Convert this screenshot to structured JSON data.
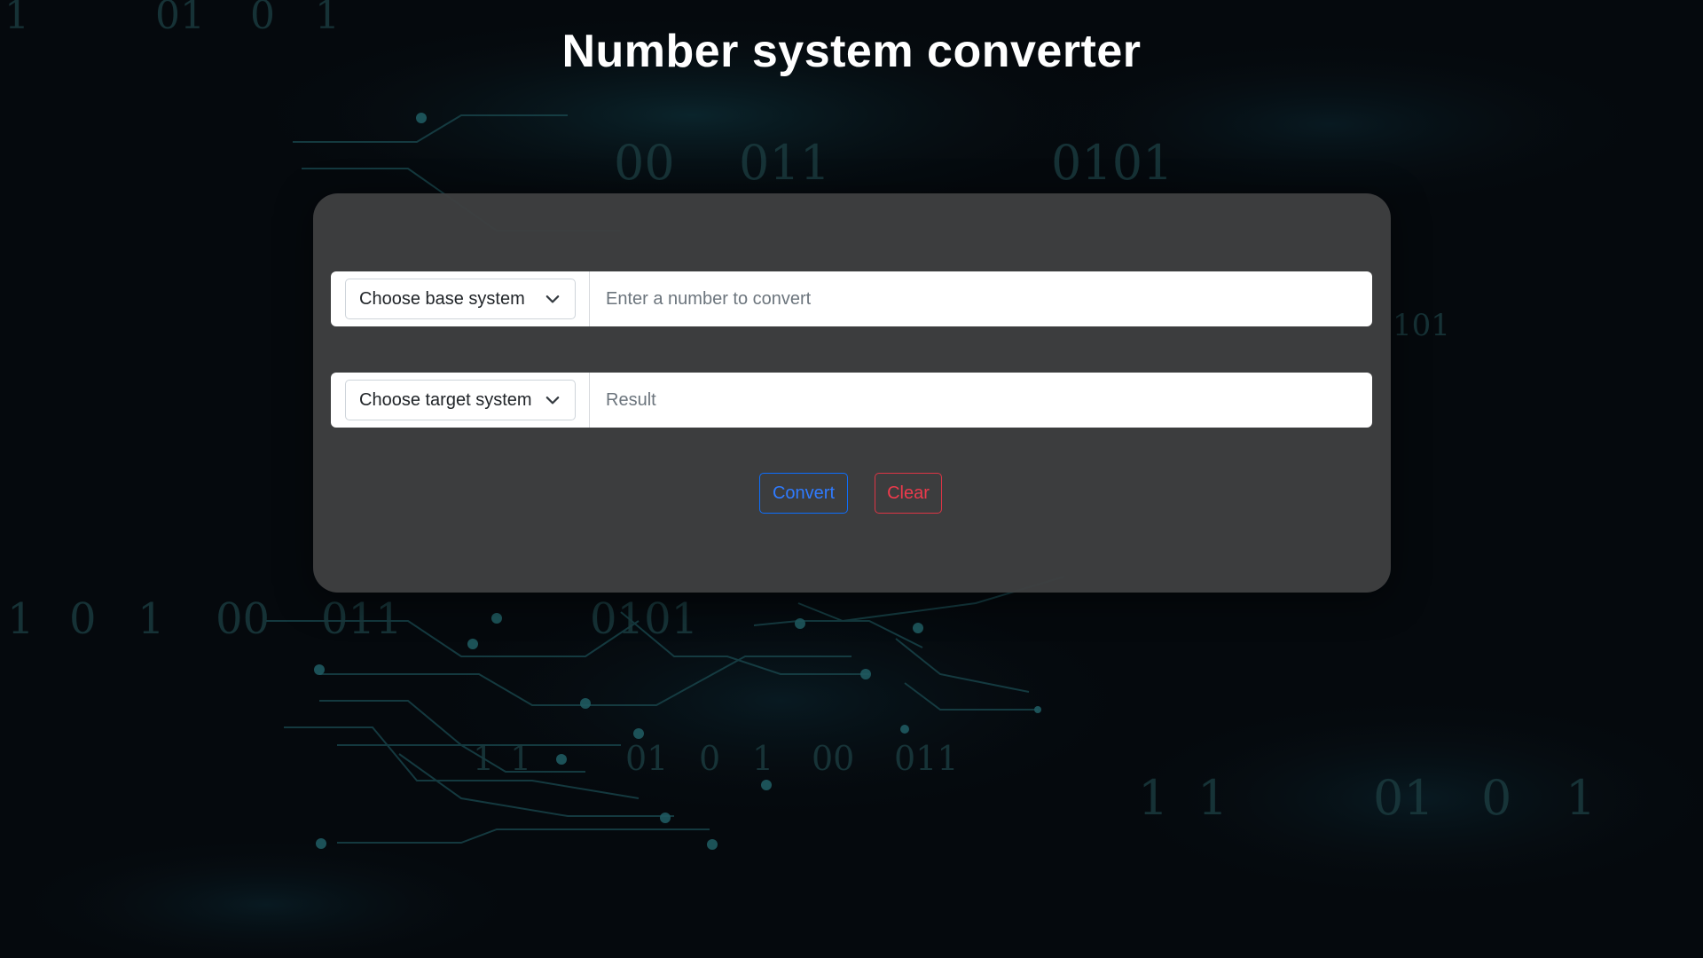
{
  "page": {
    "title": "Number system converter"
  },
  "background": {
    "binary_snippets": [
      "1",
      "01",
      "0",
      "1",
      "00",
      "011",
      "0101",
      "101",
      "1",
      "0",
      "1",
      "00",
      "011",
      "0101",
      "1",
      "1",
      "01",
      "0",
      "1",
      "00",
      "011",
      "1",
      "1",
      "01",
      "0",
      "1"
    ]
  },
  "converter": {
    "base_select": {
      "selected": "Choose base system"
    },
    "number_input": {
      "value": "",
      "placeholder": "Enter a number to convert"
    },
    "target_select": {
      "selected": "Choose target system"
    },
    "result_field": {
      "value": "",
      "placeholder": "Result"
    },
    "convert_label": "Convert",
    "clear_label": "Clear"
  },
  "colors": {
    "primary": "#0d6efd",
    "danger": "#dc3545",
    "card": "#3e3f41",
    "background": "#05090d"
  }
}
